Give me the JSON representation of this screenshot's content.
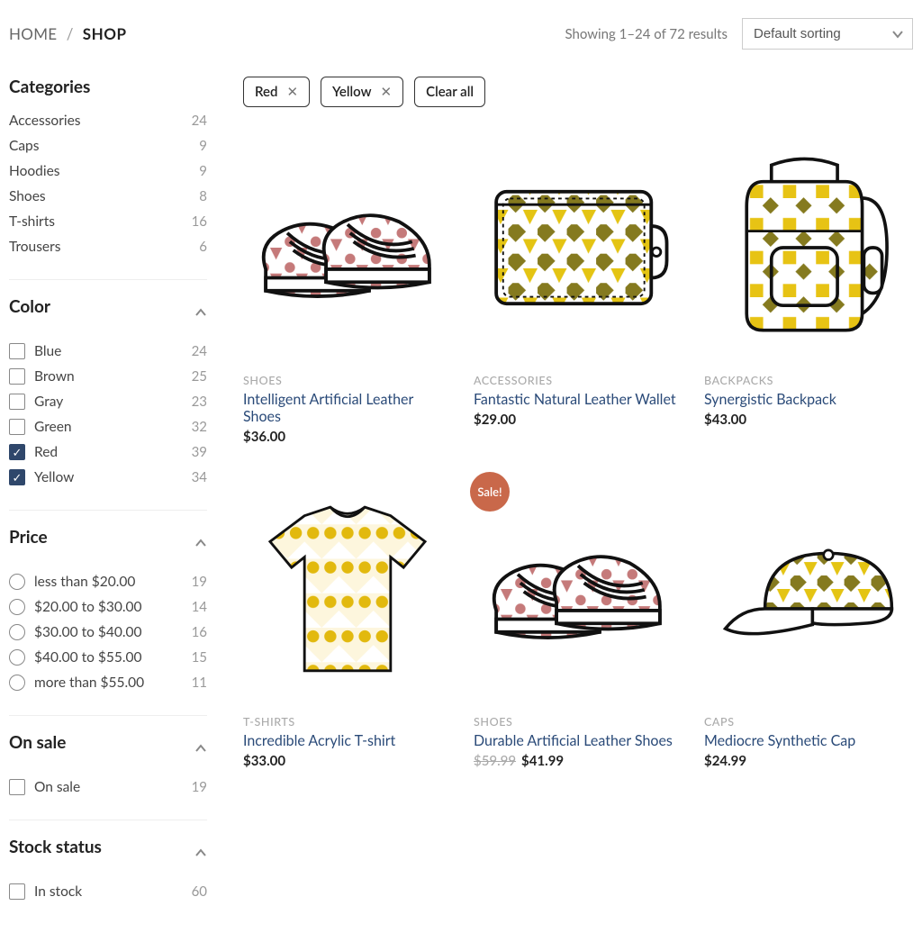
{
  "breadcrumb": {
    "home": "HOME",
    "current": "SHOP"
  },
  "results_text": "Showing 1–24 of 72 results",
  "sort": {
    "selected": "Default sorting"
  },
  "chips": [
    {
      "label": "Red"
    },
    {
      "label": "Yellow"
    }
  ],
  "clear_all": "Clear all",
  "sidebar": {
    "categories_title": "Categories",
    "categories": [
      {
        "label": "Accessories",
        "count": "24"
      },
      {
        "label": "Caps",
        "count": "9"
      },
      {
        "label": "Hoodies",
        "count": "9"
      },
      {
        "label": "Shoes",
        "count": "8"
      },
      {
        "label": "T-shirts",
        "count": "16"
      },
      {
        "label": "Trousers",
        "count": "6"
      }
    ],
    "color_title": "Color",
    "colors": [
      {
        "label": "Blue",
        "count": "24",
        "checked": false
      },
      {
        "label": "Brown",
        "count": "25",
        "checked": false
      },
      {
        "label": "Gray",
        "count": "23",
        "checked": false
      },
      {
        "label": "Green",
        "count": "32",
        "checked": false
      },
      {
        "label": "Red",
        "count": "39",
        "checked": true
      },
      {
        "label": "Yellow",
        "count": "34",
        "checked": true
      }
    ],
    "price_title": "Price",
    "prices": [
      {
        "label": "less than $20.00",
        "count": "19"
      },
      {
        "label": "$20.00 to $30.00",
        "count": "14"
      },
      {
        "label": "$30.00 to $40.00",
        "count": "16"
      },
      {
        "label": "$40.00 to $55.00",
        "count": "15"
      },
      {
        "label": "more than $55.00",
        "count": "11"
      }
    ],
    "onsale_title": "On sale",
    "onsale": {
      "label": "On sale",
      "count": "19"
    },
    "stock_title": "Stock status",
    "stock": {
      "label": "In stock",
      "count": "60"
    }
  },
  "products": [
    {
      "category": "SHOES",
      "title": "Intelligent Artificial Leather Shoes",
      "price": "$36.00",
      "svg": "shoes-red",
      "sale_label": ""
    },
    {
      "category": "ACCESSORIES",
      "title": "Fantastic Natural Leather Wallet",
      "price": "$29.00",
      "svg": "wallet",
      "sale_label": ""
    },
    {
      "category": "BACKPACKS",
      "title": "Synergistic Backpack",
      "price": "$43.00",
      "svg": "backpack",
      "sale_label": ""
    },
    {
      "category": "T-SHIRTS",
      "title": "Incredible Acrylic T-shirt",
      "price": "$33.00",
      "svg": "tshirt",
      "sale_label": ""
    },
    {
      "category": "SHOES",
      "title": "Durable Artificial Leather Shoes",
      "old_price": "$59.99",
      "price": "$41.99",
      "svg": "shoes-red",
      "sale_label": "Sale!"
    },
    {
      "category": "CAPS",
      "title": "Mediocre Synthetic Cap",
      "price": "$24.99",
      "svg": "cap",
      "sale_label": ""
    }
  ]
}
